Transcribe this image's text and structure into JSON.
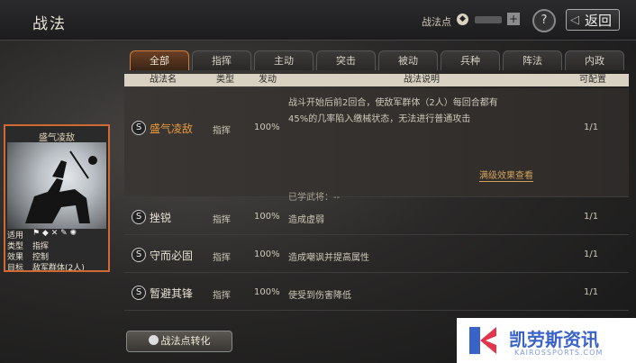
{
  "header": {
    "title": "战法",
    "points_label": "战法点",
    "back_label": "返回",
    "help_label": "?"
  },
  "tabs": [
    "全部",
    "指挥",
    "主动",
    "突击",
    "被动",
    "兵种",
    "阵法",
    "内政"
  ],
  "table_headers": [
    "战法名",
    "类型",
    "发动",
    "战法说明",
    "可配置"
  ],
  "rows": [
    {
      "grade": "S",
      "name": "盛气凌敌",
      "type": "指挥",
      "rate": "100%",
      "desc_line1": "战斗开始后前2回合，使敌军群体（2人）每回合都有",
      "desc_line2": "45%的几率陷入缴械状态，无法进行普通攻击",
      "full_effect": "满级效果查看",
      "learned": "已学武将：--",
      "config": "1/1"
    },
    {
      "grade": "S",
      "name": "挫锐",
      "type": "指挥",
      "rate": "100%",
      "desc": "造成虚弱",
      "config": "1/1"
    },
    {
      "grade": "S",
      "name": "守而必固",
      "type": "指挥",
      "rate": "100%",
      "desc": "造成嘲讽并提高属性",
      "config": "1/1"
    },
    {
      "grade": "S",
      "name": "暂避其锋",
      "type": "指挥",
      "rate": "100%",
      "desc": "使受到伤害降低",
      "config": "1/1"
    }
  ],
  "card": {
    "title": "盛气凌敌",
    "applies_label": "适用",
    "type_label": "类型",
    "type_value": "指挥",
    "effect_label": "效果",
    "effect_value": "控制",
    "target_label": "目标",
    "target_value": "敌军群体(2人)"
  },
  "convert_button": "战法点转化",
  "watermark": {
    "text": "凯劳斯资讯",
    "sub": "KAIROSSPORTS.COM"
  }
}
